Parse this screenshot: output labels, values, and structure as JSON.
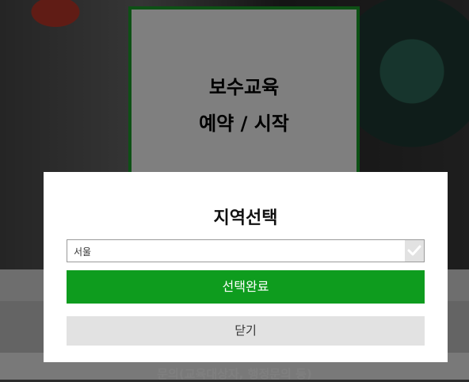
{
  "hero": {
    "card_title": "보수교육",
    "card_subtitle": "예약 / 시작"
  },
  "footer": {
    "text": "문의(교육대상자, 행정문의 등)"
  },
  "modal": {
    "title": "지역선택",
    "region_value": "서울",
    "confirm_label": "선택완료",
    "close_label": "닫기",
    "accent_color": "#0e9c1e"
  },
  "icons": {
    "check": "check-icon"
  }
}
